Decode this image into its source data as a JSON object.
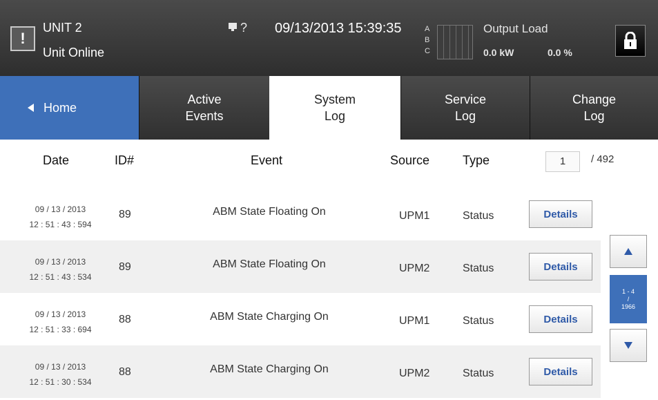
{
  "header": {
    "unit_name": "UNIT 2",
    "unit_status": "Unit Online",
    "help_label": "?",
    "datetime": "09/13/2013  15:39:35",
    "phases": [
      "A",
      "B",
      "C"
    ],
    "output_load_title": "Output Load",
    "output_kw": "0.0 kW",
    "output_pct": "0.0 %"
  },
  "tabs": {
    "home": "Home",
    "active_events_1": "Active",
    "active_events_2": "Events",
    "system_log_1": "System",
    "system_log_2": "Log",
    "service_log_1": "Service",
    "service_log_2": "Log",
    "change_log_1": "Change",
    "change_log_2": "Log"
  },
  "columns": {
    "date": "Date",
    "id": "ID#",
    "event": "Event",
    "source": "Source",
    "type": "Type"
  },
  "pagination": {
    "current_page": "1",
    "total_pages": "/ 492"
  },
  "rows": [
    {
      "date": "09 / 13 / 2013",
      "time": "12 : 51 : 43 : 594",
      "id": "89",
      "event": "ABM State Floating On",
      "source": "UPM1",
      "type": "Status",
      "action": "Details"
    },
    {
      "date": "09 / 13 / 2013",
      "time": "12 : 51 : 43 : 534",
      "id": "89",
      "event": "ABM State Floating On",
      "source": "UPM2",
      "type": "Status",
      "action": "Details"
    },
    {
      "date": "09 / 13 / 2013",
      "time": "12 : 51 : 33 : 694",
      "id": "88",
      "event": "ABM State Charging On",
      "source": "UPM1",
      "type": "Status",
      "action": "Details"
    },
    {
      "date": "09 / 13 / 2013",
      "time": "12 : 51 : 30 : 534",
      "id": "88",
      "event": "ABM State Charging On",
      "source": "UPM2",
      "type": "Status",
      "action": "Details"
    }
  ],
  "scroll": {
    "range": "1 - 4",
    "sep": "/",
    "total": "1966"
  },
  "colors": {
    "accent_blue": "#3e70b9",
    "topbar_dark": "#3a3a3a",
    "details_text": "#2f5aa8"
  },
  "icons": [
    "alarm-icon",
    "help-display-icon",
    "lock-icon",
    "left-arrow-icon",
    "up-arrow-icon",
    "down-arrow-icon"
  ]
}
